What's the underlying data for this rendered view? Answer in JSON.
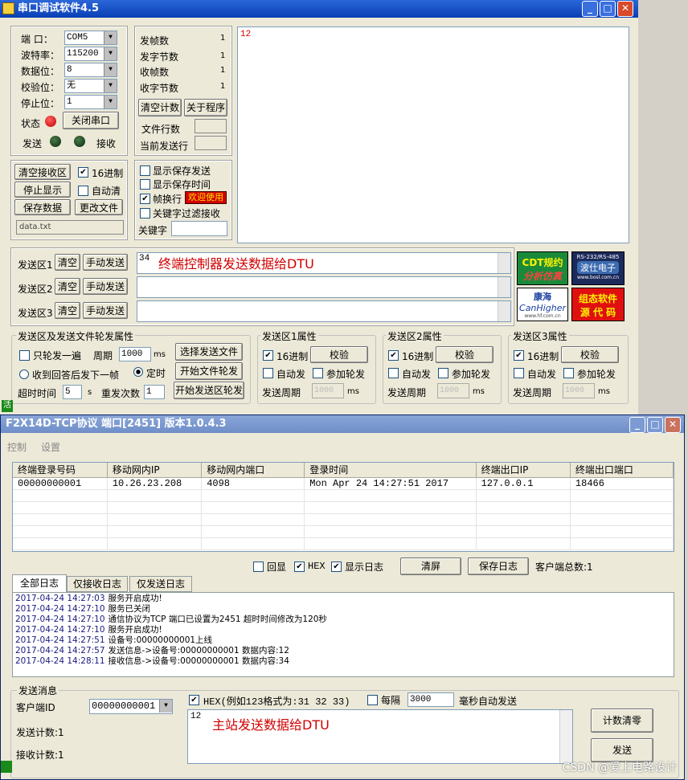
{
  "win1": {
    "title": "串口调试软件4.5",
    "port": {
      "port_label": "端  口：",
      "port_value": "COM5",
      "baud_label": "波特率：",
      "baud_value": "115200",
      "data_label": "数据位：",
      "data_value": "8",
      "parity_label": "校验位：",
      "parity_value": "无",
      "stop_label": "停止位：",
      "stop_value": "1",
      "status_label": "状态",
      "close_btn": "关闭串口",
      "send_label": "发送",
      "recv_label": "接收"
    },
    "stats": {
      "sent_frames_label": "发帧数",
      "sent_frames": "1",
      "sent_bytes_label": "发字节数",
      "sent_bytes": "1",
      "recv_frames_label": "收帧数",
      "recv_frames": "1",
      "recv_bytes_label": "收字节数",
      "recv_bytes": "1",
      "clear_btn": "清空计数",
      "about_btn": "关于程序",
      "file_lines_label": "文件行数",
      "cur_line_label": "当前发送行"
    },
    "recv_text": "12",
    "recv_ctrl": {
      "clear_btn": "清空接收区",
      "hex_label": "16进制",
      "stop_btn": "停止显示",
      "auto_clear_label": "自动清",
      "save_btn": "保存数据",
      "change_file_btn": "更改文件",
      "file_name": "data.txt"
    },
    "opts": {
      "show_save_send": "显示保存发送",
      "show_save_time": "显示保存时间",
      "frame_newline": "帧换行",
      "welcome": "欢迎使用",
      "keyword_filter": "关键字过滤接收",
      "keyword_label": "关键字"
    },
    "send_areas": [
      {
        "label": "发送区1",
        "clear": "清空",
        "manual": "手动发送",
        "value": "34",
        "note": "终端控制器发送数据给DTU"
      },
      {
        "label": "发送区2",
        "clear": "清空",
        "manual": "手动发送",
        "value": ""
      },
      {
        "label": "发送区3",
        "clear": "清空",
        "manual": "手动发送",
        "value": ""
      }
    ],
    "ads": {
      "cdt_l1": "CDT规约",
      "cdt_l2": "分析仿真",
      "rs_l1": "RS-232/RS-485",
      "rs_l2": "波仕电子",
      "rs_l3": "www.bosl.com.cn",
      "kh_l1": "康海",
      "kh_l2": "CanHigher",
      "kh_l3": "www.hf.com.cn",
      "zt_l1": "组态软件",
      "zt_l2": "源 代 码"
    },
    "rotation": {
      "group_title": "发送区及发送文件轮发属性",
      "only_once": "只轮发一遍",
      "period_label": "周期",
      "period_value": "1000",
      "ms": "ms",
      "select_file_btn": "选择发送文件",
      "wait_reply": "收到回答后发下一帧",
      "timed": "定时",
      "start_file_btn": "开始文件轮发",
      "timeout_label": "超时时间",
      "timeout_value": "5",
      "s": "s",
      "resend_label": "重发次数",
      "resend_value": "1",
      "start_area_btn": "开始发送区轮发"
    },
    "props": [
      {
        "title": "发送区1属性",
        "hex": "16进制",
        "check": "校验",
        "auto": "自动发",
        "rot": "参加轮发",
        "period": "发送周期",
        "period_value": "1000",
        "ms": "ms"
      },
      {
        "title": "发送区2属性",
        "hex": "16进制",
        "check": "校验",
        "auto": "自动发",
        "rot": "参加轮发",
        "period": "发送周期",
        "period_value": "1000",
        "ms": "ms"
      },
      {
        "title": "发送区3属性",
        "hex": "16进制",
        "check": "校验",
        "auto": "自动发",
        "rot": "参加轮发",
        "period": "发送周期",
        "period_value": "1000",
        "ms": "ms"
      }
    ],
    "status_char": "活"
  },
  "win2": {
    "title": "F2X14D-TCP协议  端口[2451] 版本1.0.4.3",
    "menu": [
      "控制",
      "设置"
    ],
    "columns": [
      "终端登录号码",
      "移动网内IP",
      "移动网内端口",
      "登录时间",
      "终端出口IP",
      "终端出口端口"
    ],
    "rows": [
      [
        "00000000001",
        "10.26.23.208",
        "4098",
        "Mon Apr 24 14:27:51 2017",
        "127.0.0.1",
        "18466"
      ]
    ],
    "echo": "回显",
    "hex": "HEX",
    "show_log": "显示日志",
    "clear_btn": "清屏",
    "save_log_btn": "保存日志",
    "client_total": "客户端总数:1",
    "tabs": [
      "全部日志",
      "仅接收日志",
      "仅发送日志"
    ],
    "logs": [
      {
        "t": "2017-04-24 14:27:03",
        "m": "服务开启成功!"
      },
      {
        "t": "2017-04-24 14:27:10",
        "m": "服务已关闭"
      },
      {
        "t": "2017-04-24 14:27:10",
        "m": "通信协议为TCP 端口已设置为2451 超时时间修改为120秒"
      },
      {
        "t": "2017-04-24 14:27:10",
        "m": "服务开启成功!"
      },
      {
        "t": "2017-04-24 14:27:51",
        "m": "设备号:00000000001上线"
      },
      {
        "t": "2017-04-24 14:27:57",
        "m": "发送信息->设备号:00000000001 数据内容:12"
      },
      {
        "t": "2017-04-24 14:28:11",
        "m": "接收信息->设备号:00000000001 数据内容:34"
      }
    ],
    "send_group": "发送消息",
    "client_id_label": "客户端ID",
    "client_id": "00000000001",
    "hex_example": "HEX(例如123格式为:31 32 33)",
    "every_label": "每隔",
    "every_value": "3000",
    "auto_send_label": "毫秒自动发送",
    "send_text": "12",
    "note": "主站发送数据给DTU",
    "send_count": "发送计数:1",
    "recv_count": "接收计数:1",
    "reset_btn": "计数清零",
    "send_btn": "发送"
  },
  "watermark": "CSDN @爱上电路设计"
}
